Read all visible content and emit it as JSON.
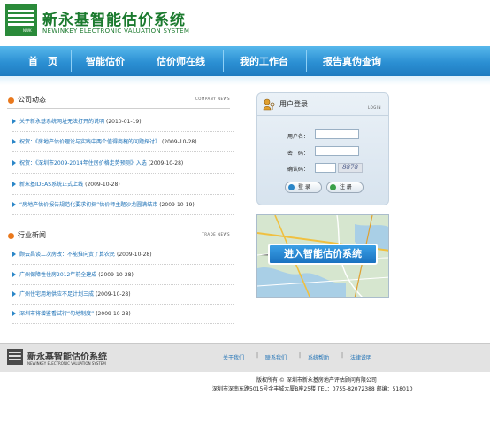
{
  "header": {
    "logo_cn": "新永基智能估价系统",
    "logo_en": "NEWINKEY ELECTRONIC VALUATION SYSTEM",
    "logo_tag": "NWK"
  },
  "nav": {
    "items": [
      "首　页",
      "智能估价",
      "估价师在线",
      "我的工作台",
      "报告真伪查询"
    ]
  },
  "company_news": {
    "title": "公司动态",
    "title_en": "COMPANY NEWS",
    "items": [
      {
        "title": "关于新永基系统网址无法打开的说明",
        "date": "(2010-01-19)"
      },
      {
        "title": "祝贺：《房地产估价理论与实践中两个值得商榷的问题探讨》",
        "date": "(2009-10-28)"
      },
      {
        "title": "祝贺：《深圳市2009-2014年住房价格走势预测》入选",
        "date": "(2009-10-28)"
      },
      {
        "title": "新永基IDEAS系统正式上线",
        "date": "(2009-10-28)"
      },
      {
        "title": "“房地产估价报告规范化要求初探”估价师主题沙龙圆满结束",
        "date": "(2009-10-19)"
      }
    ]
  },
  "industry_news": {
    "title": "行业新闻",
    "title_en": "TRADE NEWS",
    "items": [
      {
        "title": "顾云昌谈二次房改：不能推向贵了算农民",
        "date": "(2009-10-28)"
      },
      {
        "title": "广州保障性住房2012年前全建成",
        "date": "(2009-10-28)"
      },
      {
        "title": "广州住宅用地供应不足计划三成",
        "date": "(2009-10-28)"
      },
      {
        "title": "深圳市将增鉴看试行“勾地制度”",
        "date": "(2009-10-28)"
      }
    ]
  },
  "login": {
    "title": "用户登录",
    "title_en": "LOGIN",
    "username_label": "用户名：",
    "password_label": "密　码：",
    "captcha_label": "确认码：",
    "username_value": "",
    "password_value": "",
    "captcha_value": "",
    "captcha_image_text": "8878",
    "login_button": "登 录",
    "register_button": "注 册"
  },
  "banner": {
    "cta": "进入智能估价系统"
  },
  "footer": {
    "logo_cn": "新永基智能估价系统",
    "logo_en": "NEWINKEY ELECTRONIC VALUATION SYSTEM",
    "links": [
      "关于我们",
      "联系我们",
      "系统帮助",
      "法律说明"
    ],
    "separator": "|",
    "copyright": "版权所有 © 深圳市新永基房地产评估顾问有限公司",
    "address": "深圳市深南东路5015号金丰城大厦B座25楼  TEL：0755-82072388 邮编：518010"
  },
  "colors": {
    "nav_blue": "#2b8fd3",
    "brand_green": "#1b7a2e",
    "link_blue": "#1a6fb5",
    "bullet_orange": "#e9781c"
  }
}
